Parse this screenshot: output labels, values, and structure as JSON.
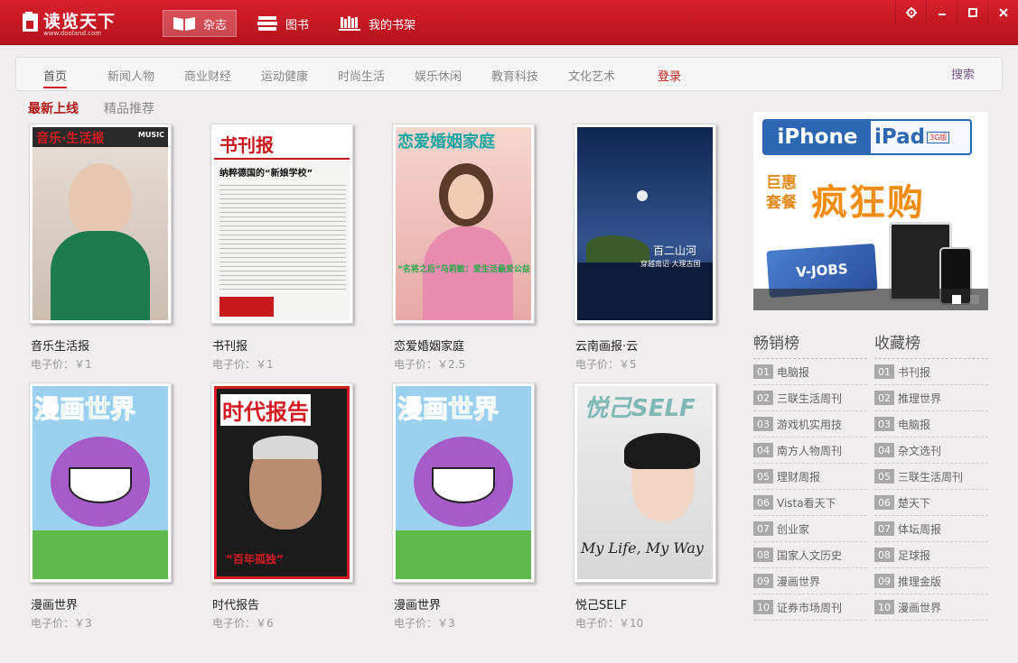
{
  "app": {
    "title": "读览天下",
    "url": "www.dooland.com"
  },
  "topnav": [
    {
      "label": "杂志",
      "icon": "magazine-icon",
      "active": true
    },
    {
      "label": "图书",
      "icon": "books-icon",
      "active": false
    },
    {
      "label": "我的书架",
      "icon": "bookshelf-icon",
      "active": false
    }
  ],
  "window_buttons": [
    "settings-icon",
    "minimize-icon",
    "maximize-icon",
    "close-icon"
  ],
  "categories": [
    {
      "label": "首页",
      "active": true
    },
    {
      "label": "新闻人物"
    },
    {
      "label": "商业财经"
    },
    {
      "label": "运动健康"
    },
    {
      "label": "时尚生活"
    },
    {
      "label": "娱乐休闲"
    },
    {
      "label": "教育科技"
    },
    {
      "label": "文化艺术"
    }
  ],
  "login_label": "登录",
  "search_label": "搜索",
  "section_tabs": [
    {
      "label": "最新上线",
      "active": true
    },
    {
      "label": "精品推荐",
      "active": false
    }
  ],
  "magazines": [
    {
      "title": "音乐生活报",
      "price": "电子价：￥1",
      "cover_text": "音乐·生活报",
      "cover_sub": "MUSIC",
      "cover_color": "#f0e6dc",
      "accent": "#d41b22"
    },
    {
      "title": "书刊报",
      "price": "电子价：￥1",
      "cover_text": "书刊报",
      "cover_sub": "纳粹德国的“新娘学校”",
      "cover_color": "#f4f4f2",
      "accent": "#c8191f"
    },
    {
      "title": "恋爱婚姻家庭",
      "price": "电子价：￥2.5",
      "cover_text": "恋爱婚姻家庭",
      "cover_sub": "“名将之后”马莉敏：爱生活最爱公益",
      "cover_color": "#f3c9c9",
      "accent": "#1aa6a0"
    },
    {
      "title": "云南画报·云",
      "price": "电子价：￥5",
      "cover_text": "百二山河",
      "cover_sub": "穿越南诏·大理古国",
      "cover_color": "#203a70",
      "accent": "#ffffff"
    },
    {
      "title": "漫画世界",
      "price": "电子价：￥3",
      "cover_text": "漫画世界",
      "cover_sub": "",
      "cover_color": "#9bd1ee",
      "accent": "#1d8f3a"
    },
    {
      "title": "时代报告",
      "price": "电子价：￥6",
      "cover_text": "时代报告",
      "cover_sub": "“百年孤独”",
      "cover_color": "#1b1b1b",
      "accent": "#d41b22"
    },
    {
      "title": "漫画世界",
      "price": "电子价：￥3",
      "cover_text": "漫画世界",
      "cover_sub": "",
      "cover_color": "#9bd1ee",
      "accent": "#1d8f3a"
    },
    {
      "title": "悦己SELF",
      "price": "电子价：￥10",
      "cover_text": "悦己SELF",
      "cover_sub": "My Life, My Way",
      "cover_color": "#e6e6e6",
      "accent": "#222222"
    }
  ],
  "ad": {
    "iphone": "iPhone",
    "ipad": "iPad",
    "ipad_badge": "3G版",
    "sub": "巨惠套餐",
    "main": "疯狂购",
    "card": "V-JOBS"
  },
  "rankings": [
    {
      "title": "畅销榜",
      "items": [
        {
          "num": "01",
          "name": "电脑报"
        },
        {
          "num": "02",
          "name": "三联生活周刊"
        },
        {
          "num": "03",
          "name": "游戏机实用技"
        },
        {
          "num": "04",
          "name": "南方人物周刊"
        },
        {
          "num": "05",
          "name": "理财周报"
        },
        {
          "num": "06",
          "name": "Vista看天下"
        },
        {
          "num": "07",
          "name": "创业家"
        },
        {
          "num": "08",
          "name": "国家人文历史"
        },
        {
          "num": "09",
          "name": "漫画世界"
        },
        {
          "num": "10",
          "name": "证券市场周刊"
        }
      ]
    },
    {
      "title": "收藏榜",
      "items": [
        {
          "num": "01",
          "name": "书刊报"
        },
        {
          "num": "02",
          "name": "推理世界"
        },
        {
          "num": "03",
          "name": "电脑报"
        },
        {
          "num": "04",
          "name": "杂文选刊"
        },
        {
          "num": "05",
          "name": "三联生活周刊"
        },
        {
          "num": "06",
          "name": "楚天下"
        },
        {
          "num": "07",
          "name": "体坛周报"
        },
        {
          "num": "08",
          "name": "足球报"
        },
        {
          "num": "09",
          "name": "推理金版"
        },
        {
          "num": "10",
          "name": "漫画世界"
        }
      ]
    }
  ],
  "colors": {
    "titlebar": "#c81a25",
    "active_category": "#cc2020",
    "section_active": "#b01818"
  }
}
